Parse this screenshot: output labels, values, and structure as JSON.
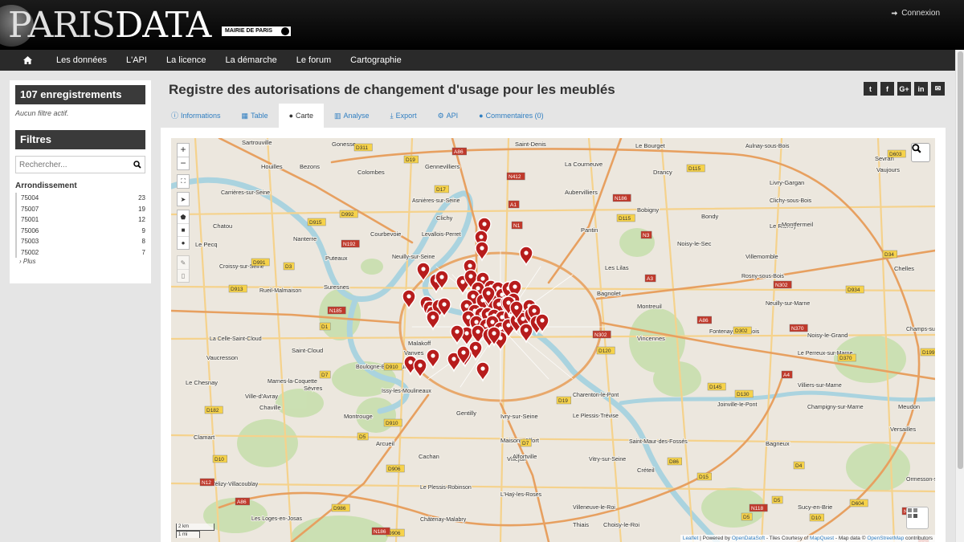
{
  "header": {
    "logo_paris": "PARIS",
    "logo_data": "DATA",
    "logo_mairie": "MAIRIE DE PARIS",
    "connexion_label": "Connexion"
  },
  "nav": {
    "items": [
      "Les données",
      "L'API",
      "La licence",
      "La démarche",
      "Le forum",
      "Cartographie"
    ]
  },
  "sidebar": {
    "record_count": "107 enregistrements",
    "no_filter": "Aucun filtre actif.",
    "filters_title": "Filtres",
    "search_placeholder": "Rechercher...",
    "facet_title": "Arrondissement",
    "facets": [
      {
        "label": "75004",
        "count": "23"
      },
      {
        "label": "75007",
        "count": "19"
      },
      {
        "label": "75001",
        "count": "12"
      },
      {
        "label": "75006",
        "count": "9"
      },
      {
        "label": "75003",
        "count": "8"
      },
      {
        "label": "75002",
        "count": "7"
      }
    ],
    "more_label": "Plus"
  },
  "page": {
    "title": "Registre des autorisations de changement d'usage pour les meublés",
    "share_icons": [
      "twitter-icon",
      "facebook-icon",
      "google-plus-icon",
      "linkedin-icon",
      "email-icon"
    ]
  },
  "tabs": [
    {
      "label": "Informations",
      "icon": "info-icon"
    },
    {
      "label": "Table",
      "icon": "table-icon"
    },
    {
      "label": "Carte",
      "icon": "globe-icon",
      "active": true
    },
    {
      "label": "Analyse",
      "icon": "chart-icon"
    },
    {
      "label": "Export",
      "icon": "download-icon"
    },
    {
      "label": "API",
      "icon": "cogs-icon"
    },
    {
      "label": "Commentaires (0)",
      "icon": "comments-icon"
    }
  ],
  "map": {
    "zoom_in": "+",
    "zoom_out": "−",
    "scale_km": "2 km",
    "scale_mi": "1 mi",
    "attribution": {
      "leaflet": "Leaflet",
      "powered": "| Powered by",
      "ods": "OpenDataSoft",
      "tiles": "- Tiles Courtesy of",
      "mapquest": "MapQuest",
      "mapdata": "- Map data ©",
      "osm": "OpenStreetMap",
      "contributors": "contributors"
    },
    "place_labels": [
      "Sartrouville",
      "Saint-Denis",
      "Le Bourget",
      "Aulnay-sous-Bois",
      "Houilles",
      "Bezons",
      "Colombes",
      "Gennevilliers",
      "La Courneuve",
      "Drancy",
      "Sevran",
      "Vaujours",
      "Carrières-sur-Seine",
      "Asnières-sur-Seine",
      "Aubervilliers",
      "Livry-Gargan",
      "Clichy-sous-Bois",
      "Bobigny",
      "Clichy",
      "Bondy",
      "Le Raincy",
      "Montfermeil",
      "Chatou",
      "Nanterre",
      "Courbevoie",
      "Levallois-Perret",
      "Pantin",
      "Noisy-le-Sec",
      "Puteaux",
      "Neuilly-sur-Seine",
      "Villemomble",
      "Chelles",
      "Les Lilas",
      "Rosny-sous-Bois",
      "Rueil-Malmaison",
      "Suresnes",
      "Bagnolet",
      "Montreuil",
      "Neuilly-sur-Marne",
      "Fontenay-sous-Bois",
      "Noisy-le-Grand",
      "Champs-sur-Marne",
      "La Celle-Saint-Cloud",
      "Saint-Cloud",
      "Vincennes",
      "Le Perreux-sur-Marne",
      "Boulogne-Billancourt",
      "Le Chesnay",
      "Ville-d'Avray",
      "Sèvres",
      "Issy-les-Moulineaux",
      "Charenton-le-Pont",
      "Joinville-le-Pont",
      "Villiers-sur-Marne",
      "Champigny-sur-Marne",
      "Meudon",
      "Montrouge",
      "Gentilly",
      "Ivry-sur-Seine",
      "Le Plessis-Trévise",
      "Versailles",
      "Clamart",
      "Arcueil",
      "Maisons-Alfort",
      "Saint-Maur-des-Fossés",
      "Bagneux",
      "Cachan",
      "Villejuif",
      "Alfortville",
      "Vitry-sur-Seine",
      "Créteil",
      "Ormesson-sur-Marne",
      "Vélizy-Villacoublay",
      "Le Plessis-Robinson",
      "L'Haÿ-les-Roses",
      "Sucy-en-Brie",
      "Châtenay-Malabry",
      "Thiais",
      "Choisy-le-Roi",
      "Vaucresson",
      "Marnes-la-Coquette",
      "Chaville",
      "Les Loges-en-Josas",
      "Villeneuve-le-Roi",
      "Croissy-sur-Seine",
      "Le Pecq",
      "Vanves",
      "Malakoff",
      "Gonesse"
    ],
    "road_labels": [
      "D311",
      "A86",
      "N412",
      "D17",
      "D19",
      "D115",
      "A1",
      "N186",
      "D915",
      "D992",
      "N1",
      "D115",
      "N3",
      "D603",
      "D991",
      "N192",
      "D3",
      "D913",
      "N185",
      "D1",
      "D7",
      "D910",
      "A3",
      "D934",
      "D34",
      "N302",
      "N370",
      "D302",
      "N302",
      "D120",
      "A86",
      "A4",
      "D370",
      "D19",
      "D145",
      "D130",
      "D7",
      "D910",
      "D182",
      "D5",
      "D906",
      "D86",
      "D4",
      "D10",
      "D15",
      "D5",
      "A86",
      "N12",
      "N118",
      "D986",
      "D906",
      "N186",
      "D5",
      "D10",
      "N104",
      "D604",
      "D199",
      "A6"
    ]
  },
  "colors": {
    "marker": "#b71c1c",
    "link": "#2f7ec1",
    "header_bg": "#000000",
    "nav_bg": "#2a2a2a"
  }
}
